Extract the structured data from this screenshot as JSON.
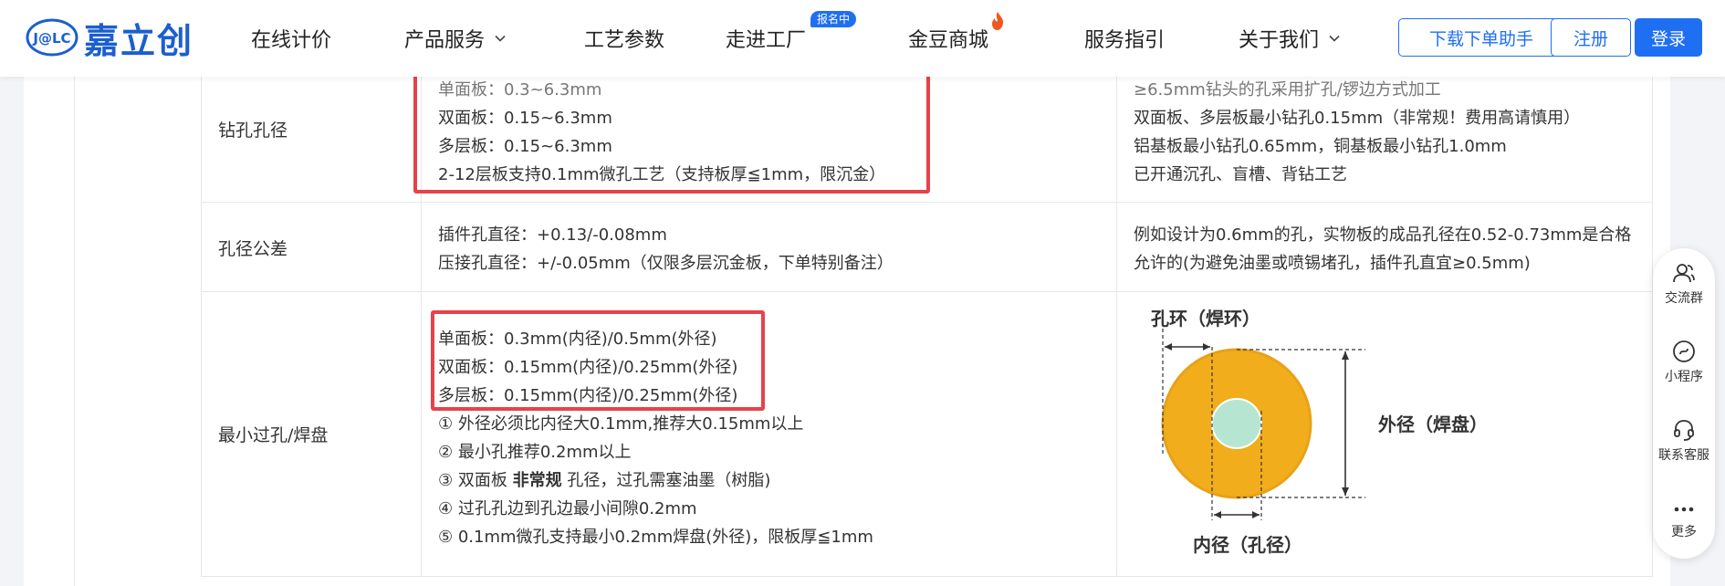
{
  "header": {
    "logo_mark_text": "J@LC",
    "logo_name": "嘉立创",
    "nav": [
      "在线计价",
      "产品服务",
      "工艺参数",
      "走进工厂",
      "金豆商城",
      "服务指引",
      "关于我们"
    ],
    "factory_badge": "报名中",
    "buttons": {
      "download": "下载下单助手",
      "register": "注册",
      "login": "登录"
    }
  },
  "rows": [
    {
      "label": "钻孔孔径",
      "spec": [
        "单面板：0.3~6.3mm",
        "双面板：0.15~6.3mm",
        "多层板：0.15~6.3mm",
        "2-12层板支持0.1mm微孔工艺（支持板厚≦1mm，限沉金）"
      ],
      "note": [
        "≥6.5mm钻头的孔采用扩孔/锣边方式加工",
        "双面板、多层板最小钻孔0.15mm（非常规！费用高请慎用）",
        "铝基板最小钻孔0.65mm，铜基板最小钻孔1.0mm",
        "已开通沉孔、盲槽、背钻工艺"
      ]
    },
    {
      "label": "孔径公差",
      "spec": [
        "插件孔直径：+0.13/-0.08mm",
        "压接孔直径：+/-0.05mm（仅限多层沉金板，下单特别备注）"
      ],
      "note": [
        "例如设计为0.6mm的孔，实物板的成品孔径在0.52-0.73mm是合格",
        "允许的(为避免油墨或喷锡堵孔，插件孔直宜≥0.5mm)"
      ]
    },
    {
      "label": "最小过孔/焊盘",
      "spec": [
        "单面板：0.3mm(内径)/0.5mm(外径)",
        "双面板：0.15mm(内径)/0.25mm(外径)",
        "多层板：0.15mm(内径)/0.25mm(外径)",
        "① 外径必须比内径大0.1mm,推荐大0.15mm以上",
        "② 最小孔推荐0.2mm以上"
      ],
      "spec_line6": {
        "prefix": "③ 双面板 ",
        "bold": "非常规",
        "suffix": " 孔径，过孔需塞油墨（树脂)"
      },
      "spec_tail": [
        "④ 过孔孔边到孔边最小间隙0.2mm",
        "⑤ 0.1mm微孔支持最小0.2mm焊盘(外径)，限板厚≦1mm"
      ],
      "diagram": {
        "ring_label": "孔环（焊环）",
        "outer_label": "外径（焊盘）",
        "inner_label": "内径（孔径）",
        "pad_color": "#f2ad1c",
        "hole_color": "#b6e6d2"
      }
    }
  ],
  "side": [
    "交流群",
    "小程序",
    "联系客服",
    "更多"
  ],
  "colors": {
    "brand": "#1f6ff2",
    "highlight": "#e5434b"
  }
}
